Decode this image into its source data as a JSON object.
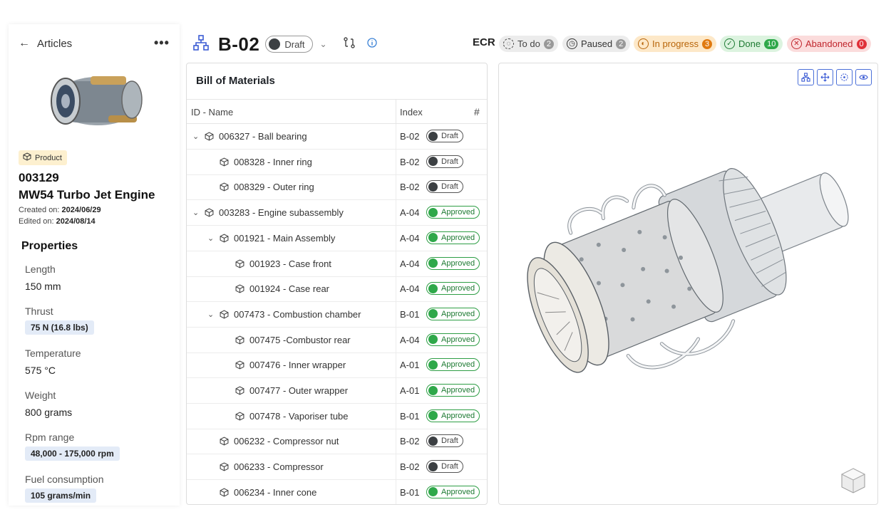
{
  "sidebar": {
    "back_label": "Articles",
    "more_label": "•••",
    "tag": "Product",
    "article_id": "003129",
    "article_name": "MW54 Turbo Jet Engine",
    "created_label": "Created on:",
    "created": "2024/06/29",
    "edited_label": "Edited on:",
    "edited": "2024/08/14",
    "properties_title": "Properties",
    "props": [
      {
        "label": "Length",
        "value": "150 mm",
        "chip": false
      },
      {
        "label": "Thrust",
        "value": "75 N (16.8 lbs)",
        "chip": true
      },
      {
        "label": "Temperature",
        "value": "575 °C",
        "chip": false
      },
      {
        "label": "Weight",
        "value": "800 grams",
        "chip": false
      },
      {
        "label": "Rpm range",
        "value": "48,000 - 175,000 rpm",
        "chip": true
      },
      {
        "label": "Fuel consumption",
        "value": "105 grams/min",
        "chip": true
      }
    ]
  },
  "header": {
    "title": "B-02",
    "status": "Draft"
  },
  "ecr": {
    "label": "ECR",
    "statuses": [
      {
        "label": "To do",
        "count": "2",
        "color": "#444",
        "bg": "#ececec",
        "cntbg": "#999",
        "cntfg": "#fff"
      },
      {
        "label": "Paused",
        "count": "2",
        "color": "#333",
        "bg": "#ececec",
        "cntbg": "#999",
        "cntfg": "#fff"
      },
      {
        "label": "In progress",
        "count": "3",
        "color": "#b8650a",
        "bg": "#fde8c8",
        "cntbg": "#e07a10",
        "cntfg": "#fff"
      },
      {
        "label": "Done",
        "count": "10",
        "color": "#1d7a32",
        "bg": "#dcf3df",
        "cntbg": "#2fa84a",
        "cntfg": "#fff"
      },
      {
        "label": "Abandoned",
        "count": "0",
        "color": "#c0262d",
        "bg": "#fbdcdc",
        "cntbg": "#e0313a",
        "cntfg": "#fff"
      }
    ]
  },
  "bom": {
    "title": "Bill of Materials",
    "col_name": "ID - Name",
    "col_index": "Index",
    "col_num": "#",
    "rows": [
      {
        "level": 0,
        "expand": true,
        "name": "006327 - Ball bearing",
        "index": "B-02",
        "status": "Draft"
      },
      {
        "level": 1,
        "expand": false,
        "name": "008328 - Inner ring",
        "index": "B-02",
        "status": "Draft"
      },
      {
        "level": 1,
        "expand": false,
        "name": "008329 - Outer ring",
        "index": "B-02",
        "status": "Draft"
      },
      {
        "level": 0,
        "expand": true,
        "name": "003283 - Engine subassembly",
        "index": "A-04",
        "status": "Approved"
      },
      {
        "level": 1,
        "expand": true,
        "name": "001921 - Main Assembly",
        "index": "A-04",
        "status": "Approved"
      },
      {
        "level": 2,
        "expand": false,
        "name": "001923 - Case front",
        "index": "A-04",
        "status": "Approved"
      },
      {
        "level": 2,
        "expand": false,
        "name": "001924 - Case rear",
        "index": "A-04",
        "status": "Approved"
      },
      {
        "level": 1,
        "expand": true,
        "name": "007473 - Combustion chamber",
        "index": "B-01",
        "status": "Approved"
      },
      {
        "level": 2,
        "expand": false,
        "name": "007475 -Combustor rear",
        "index": "A-04",
        "status": "Approved"
      },
      {
        "level": 2,
        "expand": false,
        "name": "007476 - Inner wrapper",
        "index": "A-01",
        "status": "Approved"
      },
      {
        "level": 2,
        "expand": false,
        "name": "007477 - Outer wrapper",
        "index": "A-01",
        "status": "Approved"
      },
      {
        "level": 2,
        "expand": false,
        "name": "007478 - Vaporiser tube",
        "index": "B-01",
        "status": "Approved"
      },
      {
        "level": 1,
        "expand": false,
        "name": "006232 - Compressor nut",
        "index": "B-02",
        "status": "Draft"
      },
      {
        "level": 1,
        "expand": false,
        "name": "006233 - Compressor",
        "index": "B-02",
        "status": "Draft"
      },
      {
        "level": 1,
        "expand": false,
        "name": "006234 - Inner cone",
        "index": "B-01",
        "status": "Approved"
      }
    ]
  },
  "viewer": {
    "tools": [
      "hierarchy-icon",
      "move-icon",
      "focus-icon",
      "eye-icon"
    ]
  }
}
